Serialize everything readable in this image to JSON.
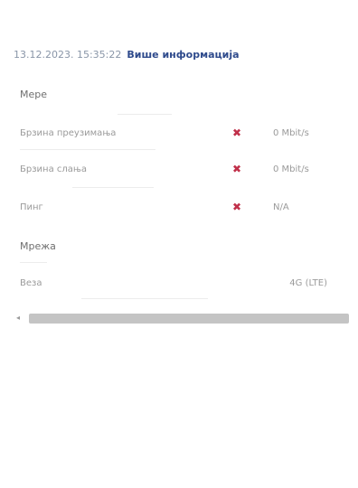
{
  "header": {
    "timestamp": "13.12.2023. 15:35:22",
    "more_info_label": "Више информација"
  },
  "sections": {
    "measures": {
      "title": "Мере",
      "rows": [
        {
          "label": "Брзина преузимања",
          "mark": "✖",
          "value": "0 Mbit/s"
        },
        {
          "label": "Брзина слања",
          "mark": "✖",
          "value": "0 Mbit/s"
        },
        {
          "label": "Пинг",
          "mark": "✖",
          "value": "N/A"
        }
      ]
    },
    "network": {
      "title": "Мрежа",
      "rows": [
        {
          "label": "Веза",
          "value": "4G (LTE)"
        }
      ]
    }
  },
  "scrollbar": {
    "left_arrow": "◂"
  }
}
